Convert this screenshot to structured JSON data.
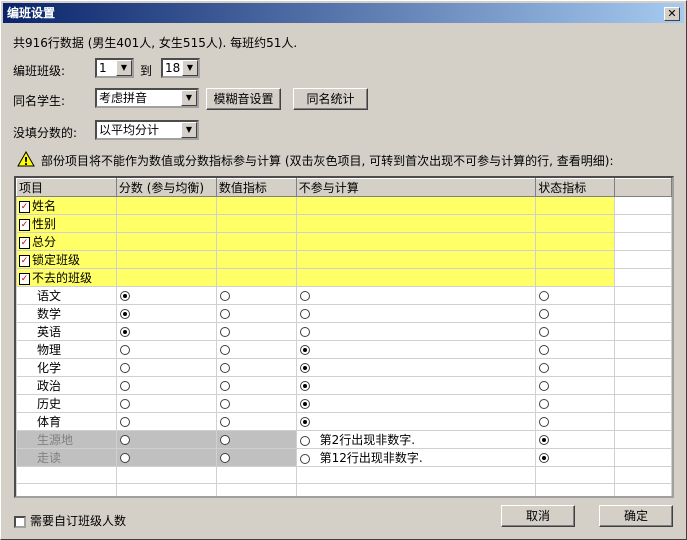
{
  "window": {
    "title": "编班设置",
    "close": "✕"
  },
  "summary": "共916行数据 (男生401人, 女生515人). 每班约51人.",
  "class_range": {
    "label": "编班班级:",
    "from": "1",
    "to_label": "到",
    "to": "18"
  },
  "same_name": {
    "label": "同名学生:",
    "value": "考虑拼音",
    "fuzzy_button": "模糊音设置",
    "stats_button": "同名统计"
  },
  "missing": {
    "label": "没填分数的:",
    "value": "以平均分计"
  },
  "warning": "部份项目将不能作为数值或分数指标参与计算 (双击灰色项目, 可转到首次出现不可参与计算的行, 查看明细):",
  "table": {
    "headers": [
      "项目",
      "分数 (参与均衡)",
      "数值指标",
      "不参与计算",
      "状态指标"
    ],
    "fixed_rows": [
      "姓名",
      "性别",
      "总分",
      "锁定班级",
      "不去的班级"
    ],
    "rows": [
      {
        "name": "语文",
        "sel": 0,
        "note": "",
        "gray": false
      },
      {
        "name": "数学",
        "sel": 0,
        "note": "",
        "gray": false
      },
      {
        "name": "英语",
        "sel": 0,
        "note": "",
        "gray": false
      },
      {
        "name": "物理",
        "sel": 2,
        "note": "",
        "gray": false
      },
      {
        "name": "化学",
        "sel": 2,
        "note": "",
        "gray": false
      },
      {
        "name": "政治",
        "sel": 2,
        "note": "",
        "gray": false
      },
      {
        "name": "历史",
        "sel": 2,
        "note": "",
        "gray": false
      },
      {
        "name": "体育",
        "sel": 2,
        "note": "",
        "gray": false
      },
      {
        "name": "生源地",
        "sel": 3,
        "note": "第2行出现非数字.",
        "gray": true
      },
      {
        "name": "走读",
        "sel": 3,
        "note": "第12行出现非数字.",
        "gray": true
      }
    ]
  },
  "custom_count": "需要自订班级人数",
  "cancel": "取消",
  "ok": "确定"
}
